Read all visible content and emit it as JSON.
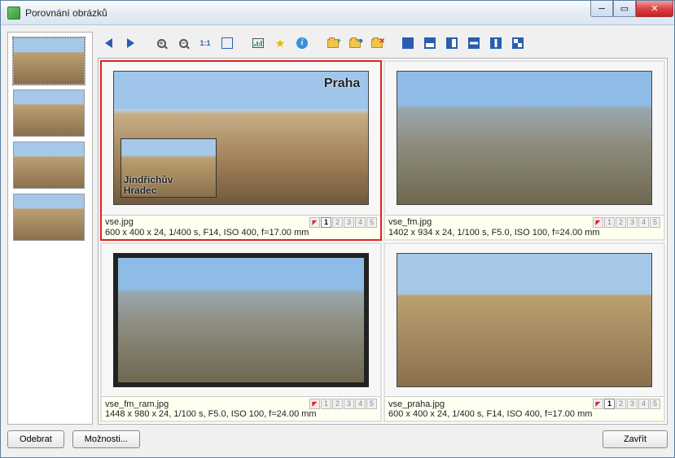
{
  "window": {
    "title": "Porovnání obrázků"
  },
  "toolbar": {
    "prev": "Předchozí",
    "next": "Další",
    "zoom_in": "Přiblížit",
    "zoom_out": "Oddálit",
    "zoom_11": "1:1",
    "fit": "Přizpůsobit",
    "fullscreen": "Celá obrazovka",
    "histogram": "Histogram",
    "star": "Hodnocení",
    "info": "Informace",
    "folder_add": "Přidat",
    "folder_move": "Přesunout",
    "folder_del": "Odebrat",
    "layout_1": "1",
    "layout_2h": "2 vodorovně",
    "layout_2v": "2 svisle",
    "layout_3h": "3",
    "layout_3v": "3 svisle",
    "layout_4": "4"
  },
  "side_thumbs": [
    {
      "file": "vse.jpg"
    },
    {
      "file": "vse_fm.jpg"
    },
    {
      "file": "vse_fm_ram.jpg"
    },
    {
      "file": "vse_praha.jpg"
    }
  ],
  "cells": [
    {
      "file": "vse.jpg",
      "meta": "600 x 400 x 24, 1/400 s, F14, ISO 400, f=17.00 mm",
      "overlay": "Praha",
      "inset_label": "Jindřichův\nHradec",
      "has_inset": true,
      "active_rating": "1",
      "flagged": false
    },
    {
      "file": "vse_fm.jpg",
      "meta": "1402 x 934 x 24, 1/100 s, F5.0, ISO 100, f=24.00 mm",
      "overlay": "",
      "has_inset": false,
      "active_rating": "",
      "flagged": true
    },
    {
      "file": "vse_fm_ram.jpg",
      "meta": "1448 x 980 x 24, 1/100 s, F5.0, ISO 100, f=24.00 mm",
      "overlay": "",
      "has_inset": false,
      "active_rating": "",
      "flagged": true
    },
    {
      "file": "vse_praha.jpg",
      "meta": "600 x 400 x 24, 1/400 s, F14, ISO 400, f=17.00 mm",
      "overlay": "",
      "has_inset": false,
      "active_rating": "1",
      "flagged": false
    }
  ],
  "buttons": {
    "remove": "Odebrat",
    "options": "Možnosti...",
    "close": "Zavřít"
  },
  "ratings": [
    "1",
    "2",
    "3",
    "4",
    "5"
  ]
}
